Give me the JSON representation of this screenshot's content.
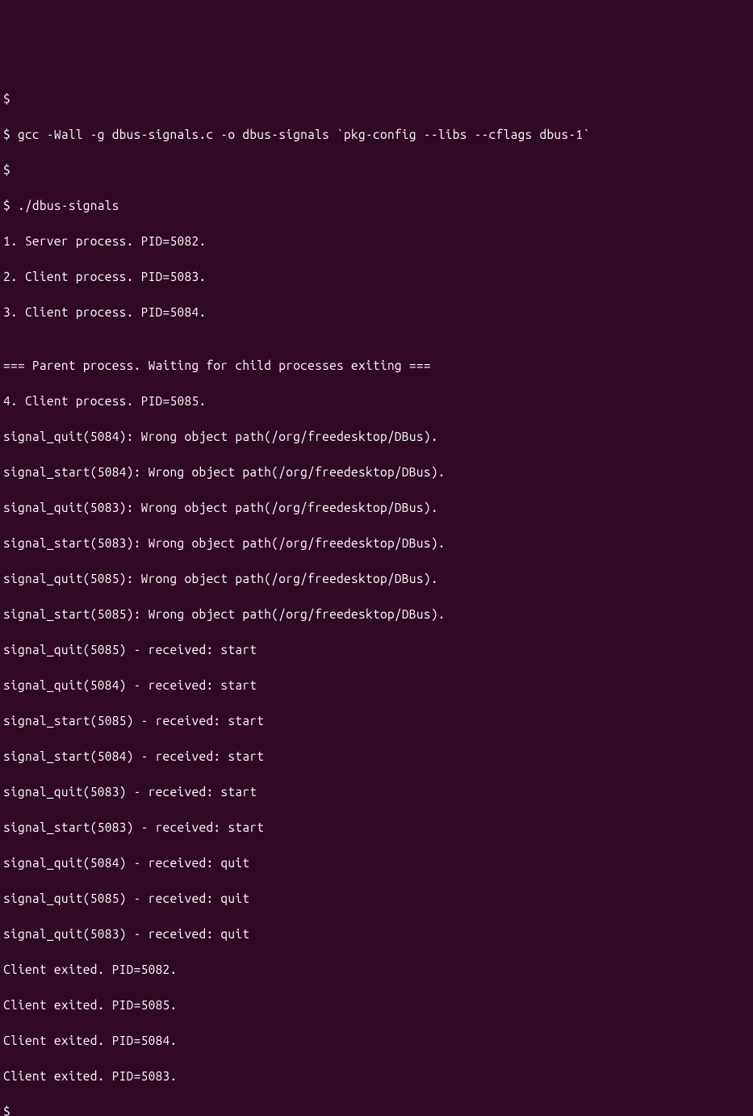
{
  "terminal": {
    "lines": [
      "$",
      "$ gcc -Wall -g dbus-signals.c -o dbus-signals `pkg-config --libs --cflags dbus-1`",
      "$",
      "$ ./dbus-signals",
      "1. Server process. PID=5082.",
      "2. Client process. PID=5083.",
      "3. Client process. PID=5084.",
      "",
      "=== Parent process. Waiting for child processes exiting ===",
      "4. Client process. PID=5085.",
      "signal_quit(5084): Wrong object path(/org/freedesktop/DBus).",
      "signal_start(5084): Wrong object path(/org/freedesktop/DBus).",
      "signal_quit(5083): Wrong object path(/org/freedesktop/DBus).",
      "signal_start(5083): Wrong object path(/org/freedesktop/DBus).",
      "signal_quit(5085): Wrong object path(/org/freedesktop/DBus).",
      "signal_start(5085): Wrong object path(/org/freedesktop/DBus).",
      "signal_quit(5085) - received: start",
      "signal_quit(5084) - received: start",
      "signal_start(5085) - received: start",
      "signal_start(5084) - received: start",
      "signal_quit(5083) - received: start",
      "signal_start(5083) - received: start",
      "signal_quit(5084) - received: quit",
      "signal_quit(5085) - received: quit",
      "signal_quit(5083) - received: quit",
      "Client exited. PID=5082.",
      "Client exited. PID=5085.",
      "Client exited. PID=5084.",
      "Client exited. PID=5083.",
      "$"
    ]
  }
}
